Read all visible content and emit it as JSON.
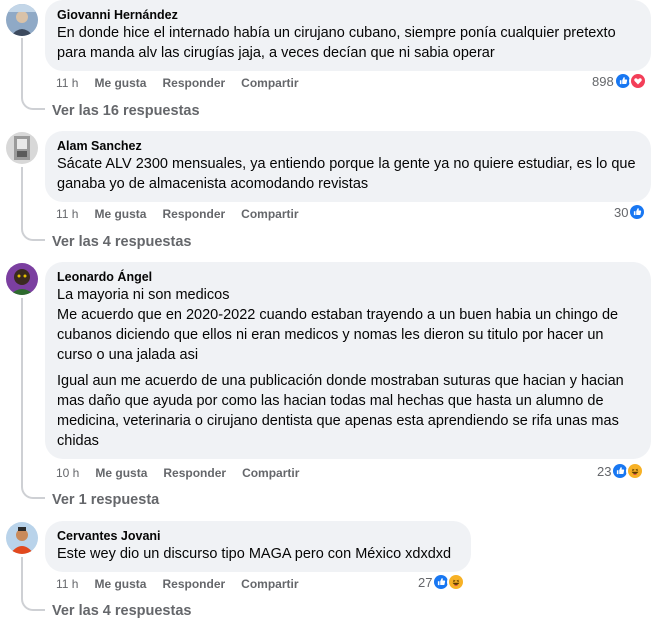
{
  "comments": [
    {
      "author": "Giovanni Hernández",
      "text": [
        "En donde hice el internado había un cirujano cubano, siempre ponía cualquier pretexto para manda alv las cirugías jaja, a veces decían que ni sabia operar"
      ],
      "time": "11 h",
      "like": "Me gusta",
      "reply": "Responder",
      "share": "Compartir",
      "reaction_count": "898",
      "reactions": [
        "like-icon",
        "love-icon"
      ],
      "replies": "Ver las 16 respuestas"
    },
    {
      "author": "Alam Sanchez",
      "text": [
        "Sácate ALV 2300 mensuales, ya entiendo porque la gente ya no quiere estudiar, es lo que ganaba yo de almacenista acomodando revistas"
      ],
      "time": "11 h",
      "like": "Me gusta",
      "reply": "Responder",
      "share": "Compartir",
      "reaction_count": "30",
      "reactions": [
        "like-icon"
      ],
      "replies": "Ver las 4 respuestas"
    },
    {
      "author": "Leonardo Ángel",
      "text": [
        "La mayoria ni son medicos\nMe acuerdo que en 2020-2022 cuando estaban trayendo a un buen habia un chingo de cubanos diciendo que ellos ni eran medicos y nomas les dieron su titulo por hacer un curso o una jalada asi",
        "Igual aun me acuerdo de una publicación donde mostraban suturas que hacian y hacian mas daño que ayuda por como las hacian todas mal hechas que hasta un alumno de medicina, veterinaria o cirujano dentista que apenas esta aprendiendo se rifa unas mas chidas"
      ],
      "time": "10 h",
      "like": "Me gusta",
      "reply": "Responder",
      "share": "Compartir",
      "reaction_count": "23",
      "reactions": [
        "like-icon",
        "haha-icon"
      ],
      "replies": "Ver 1 respuesta"
    },
    {
      "author": "Cervantes Jovani",
      "text": [
        "Este wey dio un discurso tipo MAGA pero con México xdxdxd"
      ],
      "time": "11 h",
      "like": "Me gusta",
      "reply": "Responder",
      "share": "Compartir",
      "reaction_count": "27",
      "reactions": [
        "like-icon",
        "haha-icon"
      ],
      "replies": "Ver las 4 respuestas"
    }
  ],
  "colors": {
    "bubble": "#f0f2f5",
    "meta": "#65676b",
    "like": "#1877f2",
    "love": "#f33e58",
    "haha": "#f7b125"
  }
}
